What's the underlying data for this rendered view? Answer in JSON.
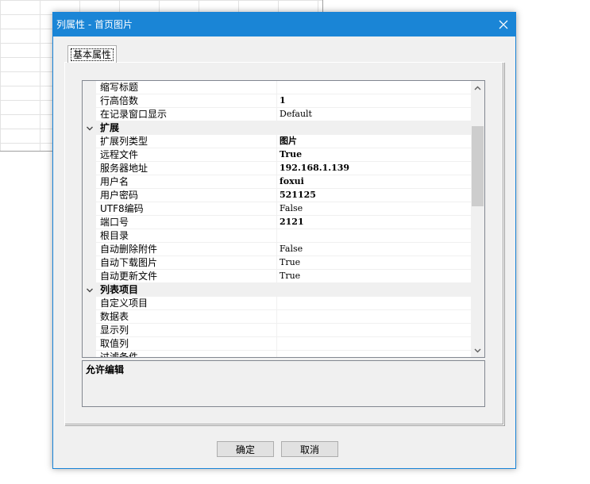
{
  "dialog": {
    "title": "列属性 - 首页图片",
    "close_icon": "close-icon"
  },
  "tabs": [
    {
      "label": "基本属性",
      "active": true
    }
  ],
  "grid": {
    "rows": [
      {
        "type": "prop",
        "name": "缩写标题",
        "value": ""
      },
      {
        "type": "prop",
        "name": "行高倍数",
        "value": "1",
        "bold": true
      },
      {
        "type": "prop",
        "name": "在记录窗口显示",
        "value": "Default"
      },
      {
        "type": "category",
        "name": "扩展",
        "expanded": true
      },
      {
        "type": "prop",
        "name": "扩展列类型",
        "value": "图片",
        "bold": true
      },
      {
        "type": "prop",
        "name": "远程文件",
        "value": "True",
        "bold": true
      },
      {
        "type": "prop",
        "name": "服务器地址",
        "value": "192.168.1.139",
        "bold": true
      },
      {
        "type": "prop",
        "name": "用户名",
        "value": "foxui",
        "bold": true
      },
      {
        "type": "prop",
        "name": "用户密码",
        "value": "521125",
        "bold": true
      },
      {
        "type": "prop",
        "name": "UTF8编码",
        "value": "False"
      },
      {
        "type": "prop",
        "name": "端口号",
        "value": "2121",
        "bold": true
      },
      {
        "type": "prop",
        "name": "根目录",
        "value": ""
      },
      {
        "type": "prop",
        "name": "自动删除附件",
        "value": "False"
      },
      {
        "type": "prop",
        "name": "自动下载图片",
        "value": "True"
      },
      {
        "type": "prop",
        "name": "自动更新文件",
        "value": "True"
      },
      {
        "type": "category",
        "name": "列表项目",
        "expanded": true
      },
      {
        "type": "prop",
        "name": "自定义项目",
        "value": ""
      },
      {
        "type": "prop",
        "name": "数据表",
        "value": ""
      },
      {
        "type": "prop",
        "name": "显示列",
        "value": ""
      },
      {
        "type": "prop",
        "name": "取值列",
        "value": ""
      },
      {
        "type": "prop",
        "name": "过滤条件",
        "value": ""
      }
    ]
  },
  "description": {
    "title": "允许编辑"
  },
  "buttons": {
    "ok": "确定",
    "cancel": "取消"
  },
  "colors": {
    "titlebar": "#1a85d6",
    "dialog_bg": "#f0f0f0"
  }
}
